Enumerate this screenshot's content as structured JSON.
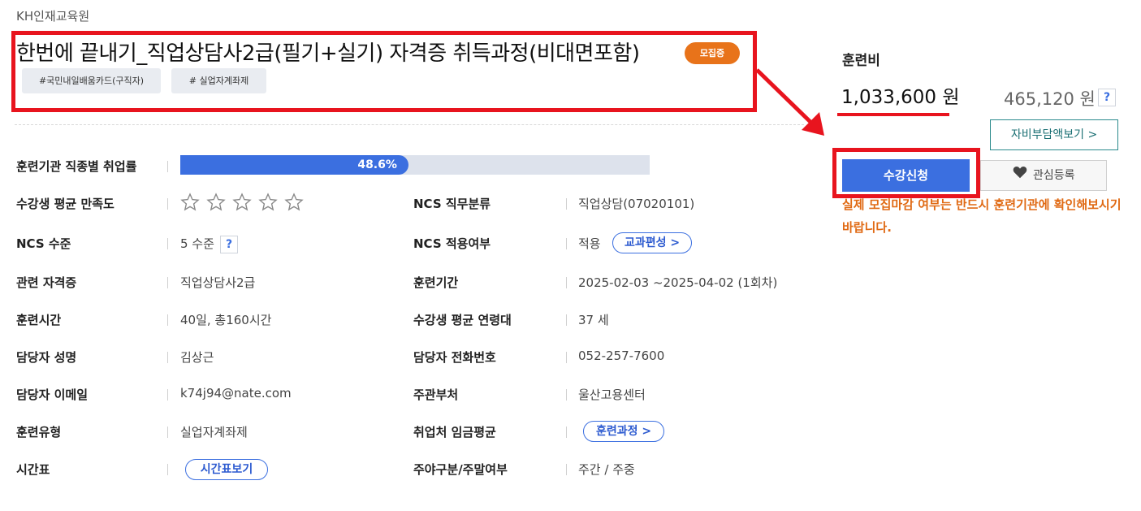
{
  "institution": "KH인재교육원",
  "course": {
    "title": "한번에 끝내기_직업상담사2급(필기+실기) 자격증 취득과정(비대면포함)",
    "badge": "모집중",
    "tags": [
      "#국민내일배움카드(구직자)",
      "# 실업자계좌제"
    ]
  },
  "employment": {
    "label": "훈련기관 직종별 취업률",
    "rate_percent": 48.6,
    "rate_text": "48.6%"
  },
  "satisfaction": {
    "label": "수강생 평균 만족도",
    "stars_filled": 0,
    "stars_total": 5
  },
  "details": {
    "ncs_level_label": "NCS 수준",
    "ncs_level_value": "5 수준",
    "help_symbol": "?",
    "cert_label": "관련 자격증",
    "cert_value": "직업상담사2급",
    "hours_label": "훈련시간",
    "hours_value": "40일, 총160시간",
    "manager_label": "담당자 성명",
    "manager_value": "김상근",
    "email_label": "담당자 이메일",
    "email_value": "k74j94@nate.com",
    "type_label": "훈련유형",
    "type_value": "실업자계좌제",
    "timetable_label": "시간표",
    "timetable_button": "시간표보기",
    "ncs_job_label": "NCS 직무분류",
    "ncs_job_value": "직업상담(07020101)",
    "ncs_apply_label": "NCS 적용여부",
    "ncs_apply_value": "적용",
    "curriculum_button": "교과편성 >",
    "period_label": "훈련기간",
    "period_value": "2025-02-03 ~2025-04-02 (1회차)",
    "age_label": "수강생 평균 연령대",
    "age_value": "37 세",
    "phone_label": "담당자 전화번호",
    "phone_value": "052-257-7600",
    "dept_label": "주관부처",
    "dept_value": "울산고용센터",
    "wage_label": "취업처 임금평균",
    "training_course_button": "훈련과정 >",
    "daynight_label": "주야구분/주말여부",
    "daynight_value": "주간 / 주중"
  },
  "fee": {
    "label": "훈련비",
    "amount": "1,033,600 원",
    "self_amount": "465,120 원",
    "self_view_button": "자비부담액보기 >"
  },
  "actions": {
    "apply_button": "수강신청",
    "wish_button": "관심등록",
    "notice": "실제 모집마감 여부는 반드시 훈련기관에 확인해보시기 바랍니다."
  },
  "colors": {
    "primary": "#3b6fe0",
    "highlight": "#e8141e",
    "badge": "#e8731a",
    "notice": "#e06a14",
    "teal": "#2a8a8c"
  }
}
